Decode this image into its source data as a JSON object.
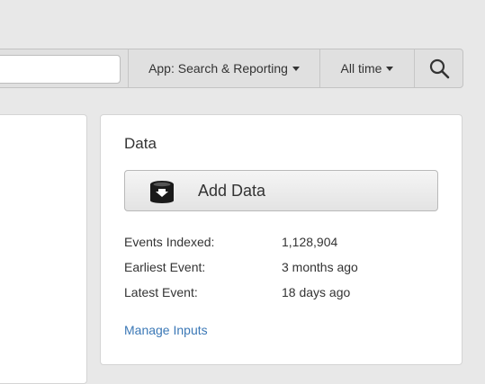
{
  "search_bar": {
    "input_value": "",
    "app_dropdown": {
      "label": "App: Search & Reporting"
    },
    "time_dropdown": {
      "label": "All time"
    },
    "search_icon": "magnifier-icon"
  },
  "data_panel": {
    "title": "Data",
    "add_data_button": {
      "label": "Add Data",
      "icon": "database-import-icon"
    },
    "stats": [
      {
        "label": "Events Indexed:",
        "value": "1,128,904"
      },
      {
        "label": "Earliest Event:",
        "value": "3 months ago"
      },
      {
        "label": "Latest Event:",
        "value": "18 days ago"
      }
    ],
    "manage_link": "Manage Inputs"
  },
  "colors": {
    "background": "#e8e8e8",
    "panel": "#ffffff",
    "link": "#3b78b6",
    "text": "#333333"
  }
}
